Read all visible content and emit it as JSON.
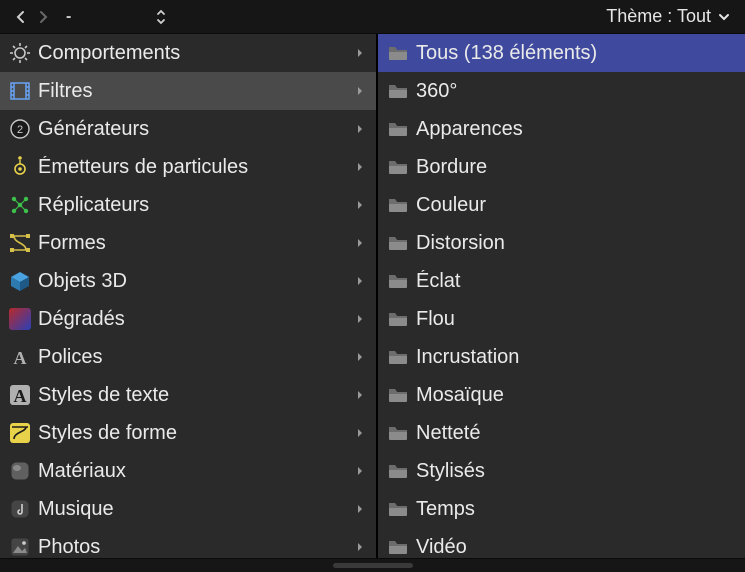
{
  "toolbar": {
    "theme_label": "Thème : Tout"
  },
  "left": {
    "selected_index": 1,
    "items": [
      {
        "label": "Comportements",
        "icon": "gear"
      },
      {
        "label": "Filtres",
        "icon": "film"
      },
      {
        "label": "Générateurs",
        "icon": "generator"
      },
      {
        "label": "Émetteurs de particules",
        "icon": "emitter"
      },
      {
        "label": "Réplicateurs",
        "icon": "replicator"
      },
      {
        "label": "Formes",
        "icon": "shape"
      },
      {
        "label": "Objets 3D",
        "icon": "cube"
      },
      {
        "label": "Dégradés",
        "icon": "gradient"
      },
      {
        "label": "Polices",
        "icon": "font"
      },
      {
        "label": "Styles de texte",
        "icon": "textstyle"
      },
      {
        "label": "Styles de forme",
        "icon": "shapestyle"
      },
      {
        "label": "Matériaux",
        "icon": "material"
      },
      {
        "label": "Musique",
        "icon": "music"
      },
      {
        "label": "Photos",
        "icon": "photos"
      }
    ]
  },
  "right": {
    "selected_index": 0,
    "items": [
      {
        "label": "Tous (138 éléments)"
      },
      {
        "label": "360°"
      },
      {
        "label": "Apparences"
      },
      {
        "label": "Bordure"
      },
      {
        "label": "Couleur"
      },
      {
        "label": "Distorsion"
      },
      {
        "label": "Éclat"
      },
      {
        "label": "Flou"
      },
      {
        "label": "Incrustation"
      },
      {
        "label": "Mosaïque"
      },
      {
        "label": "Netteté"
      },
      {
        "label": "Stylisés"
      },
      {
        "label": "Temps"
      },
      {
        "label": "Vidéo"
      }
    ]
  }
}
